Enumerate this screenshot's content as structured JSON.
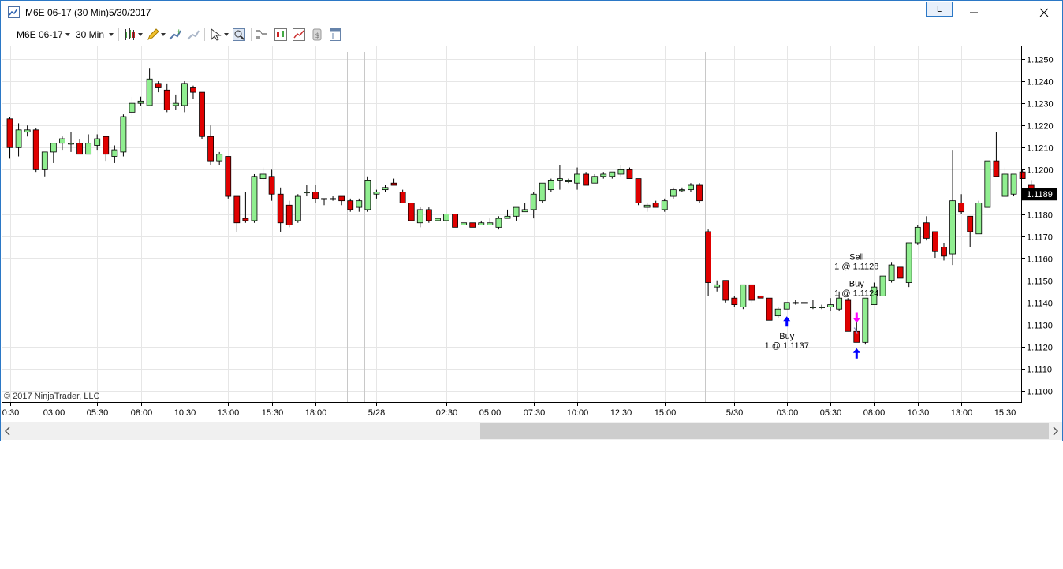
{
  "window": {
    "title": "M6E 06-17 (30 Min)",
    "date": "5/30/2017",
    "link_label": "L",
    "minimize_label": "—",
    "maximize_label": "☐",
    "close_label": "✕"
  },
  "toolbar": {
    "instrument": "M6E 06-17",
    "interval": "30 Min",
    "icons": [
      "chart-style-icon",
      "drawing-tool-icon",
      "add-indicator-icon",
      "remove-indicator-icon",
      "pointer-icon",
      "zoom-icon",
      "strategies-icon",
      "chart-trader-icon",
      "performance-icon",
      "money-icon",
      "properties-icon"
    ]
  },
  "colors": {
    "up_fill": "#90ee90",
    "down_fill": "#e00000",
    "buy_arrow": "#0000ff",
    "sell_arrow": "#ff00ff",
    "price_marker_bg": "#000000",
    "grid": "#e6e6e6"
  },
  "chart": {
    "copyright": "© 2017 NinjaTrader, LLC",
    "price_marker": "1.1189",
    "price_marker_value": 1.1189,
    "y_ticks": [
      "1.1250",
      "1.1240",
      "1.1230",
      "1.1220",
      "1.1210",
      "1.1200",
      "1.1190",
      "1.1180",
      "1.1170",
      "1.1160",
      "1.1150",
      "1.1140",
      "1.1130",
      "1.1120",
      "1.1110",
      "1.1100"
    ],
    "x_ticks": [
      {
        "label": "0:30",
        "bar": 0
      },
      {
        "label": "03:00",
        "bar": 5
      },
      {
        "label": "05:30",
        "bar": 10
      },
      {
        "label": "08:00",
        "bar": 15
      },
      {
        "label": "10:30",
        "bar": 20
      },
      {
        "label": "13:00",
        "bar": 25
      },
      {
        "label": "15:30",
        "bar": 30
      },
      {
        "label": "18:00",
        "bar": 35
      },
      {
        "label": "5/28",
        "bar": 42
      },
      {
        "label": "02:30",
        "bar": 50
      },
      {
        "label": "05:00",
        "bar": 55
      },
      {
        "label": "07:30",
        "bar": 60
      },
      {
        "label": "10:00",
        "bar": 65
      },
      {
        "label": "12:30",
        "bar": 70
      },
      {
        "label": "15:00",
        "bar": 75
      },
      {
        "label": "5/30",
        "bar": 83
      },
      {
        "label": "03:00",
        "bar": 89
      },
      {
        "label": "05:30",
        "bar": 94
      },
      {
        "label": "08:00",
        "bar": 99
      },
      {
        "label": "10:30",
        "bar": 104
      },
      {
        "label": "13:00",
        "bar": 109
      },
      {
        "label": "15:30",
        "bar": 114
      }
    ],
    "session_separators": [
      38.6,
      40.6,
      42.6,
      79.6
    ],
    "executions": [
      {
        "type": "buy",
        "bar": 89,
        "price": 1.1137,
        "label1": "Buy",
        "label2": "1 @ 1.1137",
        "label_pos": "below"
      },
      {
        "type": "sell",
        "bar": 97,
        "price": 1.1128,
        "label1": "Sell",
        "label2": "1 @ 1.1128",
        "label_pos": "above"
      },
      {
        "type": "buy",
        "bar": 97,
        "price": 1.1124,
        "label1": "Buy",
        "label2": "1 @ 1.1124",
        "label_pos": "above-near"
      }
    ]
  },
  "chart_data": {
    "type": "candlestick",
    "instrument": "M6E 06-17",
    "interval": "30 Min",
    "ylim": [
      1.1095,
      1.1255
    ],
    "candles": [
      [
        1.1223,
        1.1224,
        1.1205,
        1.121
      ],
      [
        1.121,
        1.1221,
        1.1206,
        1.1218
      ],
      [
        1.1217,
        1.122,
        1.1215,
        1.1218
      ],
      [
        1.1218,
        1.1219,
        1.1199,
        1.12
      ],
      [
        1.12,
        1.1206,
        1.1197,
        1.1208
      ],
      [
        1.1208,
        1.1212,
        1.1203,
        1.1212
      ],
      [
        1.1212,
        1.1215,
        1.1209,
        1.1214
      ],
      [
        1.1212,
        1.1217,
        1.1208,
        1.1212
      ],
      [
        1.1212,
        1.1214,
        1.1207,
        1.1207
      ],
      [
        1.1207,
        1.1216,
        1.1207,
        1.1212
      ],
      [
        1.1211,
        1.1216,
        1.1209,
        1.1214
      ],
      [
        1.1215,
        1.1215,
        1.1204,
        1.1207
      ],
      [
        1.1206,
        1.1211,
        1.1203,
        1.1209
      ],
      [
        1.1208,
        1.1225,
        1.1206,
        1.1224
      ],
      [
        1.1226,
        1.1233,
        1.1224,
        1.123
      ],
      [
        1.123,
        1.1233,
        1.1229,
        1.1231
      ],
      [
        1.1229,
        1.1246,
        1.1229,
        1.1241
      ],
      [
        1.1239,
        1.124,
        1.1235,
        1.1237
      ],
      [
        1.1236,
        1.1239,
        1.1226,
        1.1227
      ],
      [
        1.1229,
        1.1234,
        1.1227,
        1.123
      ],
      [
        1.1229,
        1.124,
        1.1226,
        1.1239
      ],
      [
        1.1237,
        1.1238,
        1.1232,
        1.1235
      ],
      [
        1.1235,
        1.1235,
        1.1214,
        1.1215
      ],
      [
        1.1215,
        1.122,
        1.1202,
        1.1204
      ],
      [
        1.1204,
        1.1208,
        1.1202,
        1.1207
      ],
      [
        1.1206,
        1.1206,
        1.1187,
        1.1188
      ],
      [
        1.1188,
        1.1188,
        1.1172,
        1.1176
      ],
      [
        1.1178,
        1.119,
        1.1176,
        1.1177
      ],
      [
        1.1177,
        1.1198,
        1.1176,
        1.1197
      ],
      [
        1.1196,
        1.1201,
        1.1195,
        1.1198
      ],
      [
        1.1197,
        1.12,
        1.1186,
        1.1189
      ],
      [
        1.1189,
        1.1192,
        1.1172,
        1.1176
      ],
      [
        1.1184,
        1.1186,
        1.1174,
        1.1175
      ],
      [
        1.1177,
        1.1189,
        1.1176,
        1.1188
      ],
      [
        1.119,
        1.1193,
        1.1188,
        1.119
      ],
      [
        1.119,
        1.1193,
        1.1185,
        1.1187
      ],
      [
        1.1187,
        1.1187,
        1.1184,
        1.1187
      ],
      [
        1.1187,
        1.1188,
        1.1186,
        1.1187
      ],
      [
        1.1188,
        1.1188,
        1.1184,
        1.1186
      ],
      [
        1.1186,
        1.1187,
        1.1181,
        1.1182
      ],
      [
        1.1183,
        1.1187,
        1.1181,
        1.1186
      ],
      [
        1.1182,
        1.1197,
        1.1181,
        1.1195
      ],
      [
        1.1189,
        1.1191,
        1.1187,
        1.119
      ],
      [
        1.1191,
        1.1193,
        1.119,
        1.1192
      ],
      [
        1.1194,
        1.1196,
        1.1193,
        1.1193
      ],
      [
        1.119,
        1.1191,
        1.1185,
        1.1185
      ],
      [
        1.1185,
        1.1185,
        1.1177,
        1.1177
      ],
      [
        1.1176,
        1.1183,
        1.1174,
        1.1182
      ],
      [
        1.1182,
        1.1183,
        1.1176,
        1.1177
      ],
      [
        1.1177,
        1.1178,
        1.1177,
        1.1178
      ],
      [
        1.1177,
        1.118,
        1.1177,
        1.118
      ],
      [
        1.118,
        1.118,
        1.1174,
        1.1174
      ],
      [
        1.1175,
        1.1176,
        1.1175,
        1.1176
      ],
      [
        1.1176,
        1.1176,
        1.1174,
        1.1174
      ],
      [
        1.1175,
        1.1177,
        1.1175,
        1.1176
      ],
      [
        1.1175,
        1.1178,
        1.1175,
        1.1176
      ],
      [
        1.1174,
        1.1179,
        1.1173,
        1.1178
      ],
      [
        1.1178,
        1.1182,
        1.1178,
        1.1179
      ],
      [
        1.1179,
        1.1183,
        1.1177,
        1.1183
      ],
      [
        1.1181,
        1.1185,
        1.1181,
        1.1182
      ],
      [
        1.1182,
        1.119,
        1.1178,
        1.1189
      ],
      [
        1.1186,
        1.1194,
        1.1185,
        1.1194
      ],
      [
        1.1191,
        1.1196,
        1.119,
        1.1195
      ],
      [
        1.1195,
        1.1202,
        1.1191,
        1.1196
      ],
      [
        1.1195,
        1.1196,
        1.1194,
        1.1195
      ],
      [
        1.1194,
        1.1201,
        1.1191,
        1.1198
      ],
      [
        1.1198,
        1.1199,
        1.1193,
        1.1193
      ],
      [
        1.1194,
        1.1198,
        1.1194,
        1.1197
      ],
      [
        1.1197,
        1.1199,
        1.1196,
        1.1198
      ],
      [
        1.1197,
        1.1199,
        1.1196,
        1.1199
      ],
      [
        1.1198,
        1.1202,
        1.1197,
        1.12
      ],
      [
        1.12,
        1.1201,
        1.1196,
        1.1196
      ],
      [
        1.1196,
        1.1196,
        1.1184,
        1.1185
      ],
      [
        1.1183,
        1.1185,
        1.1181,
        1.1184
      ],
      [
        1.1185,
        1.1186,
        1.1183,
        1.1183
      ],
      [
        1.1182,
        1.1187,
        1.1181,
        1.1186
      ],
      [
        1.1188,
        1.1192,
        1.1187,
        1.1191
      ],
      [
        1.1191,
        1.1192,
        1.119,
        1.1191
      ],
      [
        1.1191,
        1.1194,
        1.119,
        1.1193
      ],
      [
        1.1193,
        1.1194,
        1.1185,
        1.1186
      ],
      [
        1.1172,
        1.1173,
        1.1143,
        1.1149
      ],
      [
        1.1147,
        1.115,
        1.1145,
        1.1148
      ],
      [
        1.115,
        1.115,
        1.114,
        1.1141
      ],
      [
        1.1142,
        1.1143,
        1.1138,
        1.1139
      ],
      [
        1.1138,
        1.1148,
        1.1137,
        1.1148
      ],
      [
        1.1148,
        1.1148,
        1.114,
        1.1141
      ],
      [
        1.1143,
        1.1143,
        1.1142,
        1.1142
      ],
      [
        1.1142,
        1.1142,
        1.1132,
        1.1132
      ],
      [
        1.1134,
        1.1138,
        1.1133,
        1.1137
      ],
      [
        1.1137,
        1.114,
        1.1137,
        1.114
      ],
      [
        1.114,
        1.1141,
        1.1139,
        1.114
      ],
      [
        1.114,
        1.114,
        1.114,
        1.114
      ],
      [
        1.1138,
        1.1141,
        1.1137,
        1.1138
      ],
      [
        1.1138,
        1.1139,
        1.1137,
        1.1138
      ],
      [
        1.1138,
        1.1142,
        1.1136,
        1.1139
      ],
      [
        1.1137,
        1.1145,
        1.1136,
        1.1142
      ],
      [
        1.1141,
        1.1142,
        1.1127,
        1.1127
      ],
      [
        1.1127,
        1.1133,
        1.1122,
        1.1122
      ],
      [
        1.1122,
        1.1142,
        1.1121,
        1.1142
      ],
      [
        1.1139,
        1.1149,
        1.114,
        1.1147
      ],
      [
        1.1143,
        1.1152,
        1.1145,
        1.1152
      ],
      [
        1.115,
        1.1158,
        1.1149,
        1.1157
      ],
      [
        1.1156,
        1.1156,
        1.1151,
        1.1151
      ],
      [
        1.1149,
        1.1167,
        1.1147,
        1.1167
      ],
      [
        1.1167,
        1.1175,
        1.1166,
        1.1174
      ],
      [
        1.1176,
        1.1179,
        1.1168,
        1.1169
      ],
      [
        1.1172,
        1.1172,
        1.116,
        1.1163
      ],
      [
        1.1165,
        1.1167,
        1.1159,
        1.1161
      ],
      [
        1.1162,
        1.1209,
        1.1157,
        1.1186
      ],
      [
        1.1185,
        1.1189,
        1.118,
        1.1181
      ],
      [
        1.1179,
        1.1179,
        1.1165,
        1.1172
      ],
      [
        1.1171,
        1.1186,
        1.1171,
        1.1185
      ],
      [
        1.1183,
        1.1204,
        1.1183,
        1.1204
      ],
      [
        1.1204,
        1.1217,
        1.1197,
        1.1197
      ],
      [
        1.1188,
        1.1201,
        1.1188,
        1.1198
      ],
      [
        1.1189,
        1.1198,
        1.1188,
        1.1198
      ],
      [
        1.1199,
        1.12,
        1.1196,
        1.1196
      ],
      [
        1.1193,
        1.1195,
        1.1189,
        1.1189
      ]
    ]
  }
}
